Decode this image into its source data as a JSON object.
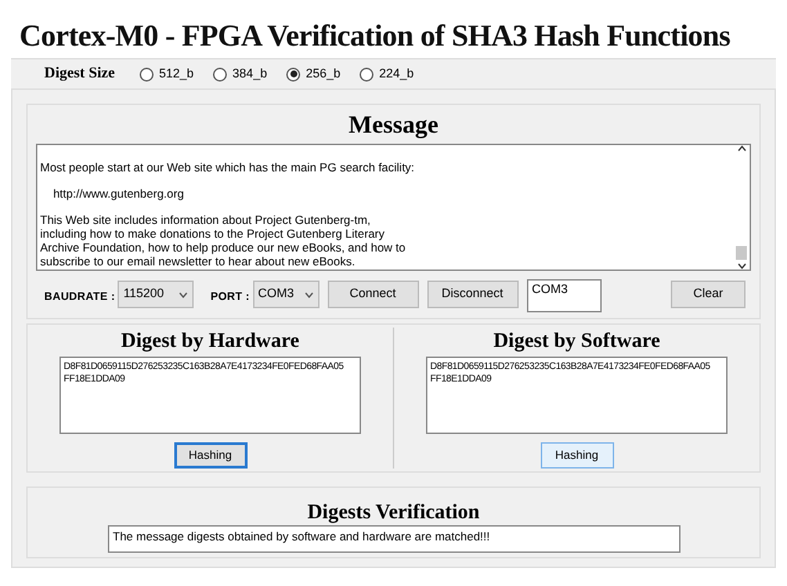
{
  "title": "Cortex-M0 - FPGA Verification of SHA3 Hash Functions",
  "digest_size": {
    "label": "Digest Size",
    "options": [
      {
        "label": "512_b",
        "selected": false
      },
      {
        "label": "384_b",
        "selected": false
      },
      {
        "label": "256_b",
        "selected": true
      },
      {
        "label": "224_b",
        "selected": false
      }
    ]
  },
  "message": {
    "heading": "Message",
    "paragraphs": [
      [
        "Most people start at our Web site which has the main PG search facility:"
      ],
      [
        "    http://www.gutenberg.org"
      ],
      [
        "This Web site includes information about Project Gutenberg-tm,",
        "including how to make donations to the Project Gutenberg Literary",
        "Archive Foundation, how to help produce our new eBooks, and how to",
        "subscribe to our email newsletter to hear about new eBooks."
      ]
    ]
  },
  "connection": {
    "baudrate_label": "BAUDRATE :",
    "baudrate": "115200",
    "port_label": "PORT :",
    "port": "COM3",
    "buttons": [
      {
        "label": "Connect"
      },
      {
        "label": "Disconnect"
      }
    ],
    "status": "COM3",
    "clear": "Clear"
  },
  "hardware": {
    "heading": "Digest by Hardware",
    "digest": "D8F81D0659115D276253235C163B28A7E4173234FE0FED68FAA05\nFF18E1DDA09",
    "button": "Hashing",
    "focused": true
  },
  "software": {
    "heading": "Digest by Software",
    "digest": "D8F81D0659115D276253235C163B28A7E4173234FE0FED68FAA05\nFF18E1DDA09",
    "button": "Hashing",
    "focused": false
  },
  "verification": {
    "heading": "Digests Verification",
    "result": "The message digests obtained by software and hardware are matched!!!"
  }
}
